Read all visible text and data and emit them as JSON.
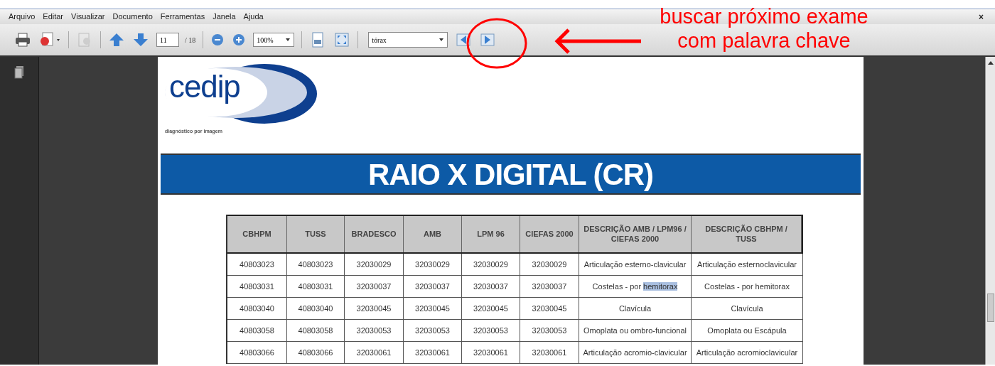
{
  "menu_bar": {
    "items": [
      "Arquivo",
      "Editar",
      "Visualizar",
      "Documento",
      "Ferramentas",
      "Janela",
      "Ajuda"
    ],
    "close": "×"
  },
  "toolbar": {
    "page_field": "11",
    "page_total": "/ 18",
    "zoom": "100%",
    "search": "tórax",
    "tools": [
      {
        "kind": "print",
        "disabled": false
      },
      {
        "kind": "share",
        "disabled": false
      },
      {
        "kind": "sep"
      },
      {
        "kind": "sign",
        "disabled": true
      },
      {
        "kind": "sep"
      },
      {
        "kind": "prev_page",
        "disabled": false
      },
      {
        "kind": "next_page",
        "disabled": false
      },
      {
        "kind": "page"
      },
      {
        "kind": "sep"
      },
      {
        "kind": "zoom_out",
        "disabled": false
      },
      {
        "kind": "zoom_in",
        "disabled": false
      },
      {
        "kind": "zoom"
      },
      {
        "kind": "sep"
      },
      {
        "kind": "fit_page",
        "disabled": false
      },
      {
        "kind": "full_screen",
        "disabled": false
      },
      {
        "kind": "sep"
      },
      {
        "kind": "search"
      },
      {
        "kind": "find_prev",
        "disabled": false
      },
      {
        "kind": "find_next",
        "disabled": false
      }
    ]
  },
  "annotation": {
    "text_lines": [
      "buscar próximo exame",
      "com palavra chave"
    ]
  },
  "document": {
    "logo_text": "cedip",
    "logo_tagline": "diagnóstico por imagem",
    "banner": "RAIO X DIGITAL (CR)",
    "table": {
      "columns": [
        "CBHPM",
        "TUSS",
        "BRADESCO",
        "AMB",
        "LPM 96",
        "CIEFAS 2000",
        "DESCRIÇÃO AMB / LPM96 / CIEFAS 2000",
        "DESCRIÇÃO CBHPM / TUSS"
      ],
      "rows": [
        [
          "40803023",
          "40803023",
          "32030029",
          "32030029",
          "32030029",
          "32030029",
          "Articulação esterno-clavicular",
          "Articulação esternoclavicular"
        ],
        [
          "40803031",
          "40803031",
          "32030037",
          "32030037",
          "32030037",
          "32030037",
          {
            "text": "Costelas - por ",
            "match": "hemitorax"
          },
          "Costelas - por hemitorax"
        ],
        [
          "40803040",
          "40803040",
          "32030045",
          "32030045",
          "32030045",
          "32030045",
          "Clavícula",
          "Clavícula"
        ],
        [
          "40803058",
          "40803058",
          "32030053",
          "32030053",
          "32030053",
          "32030053",
          "Omoplata ou ombro-funcional",
          "Omoplata ou Escápula"
        ],
        [
          "40803066",
          "40803066",
          "32030061",
          "32030061",
          "32030061",
          "32030061",
          "Articulação acromio-clavicular",
          "Articulação acromioclavicular"
        ]
      ]
    }
  }
}
